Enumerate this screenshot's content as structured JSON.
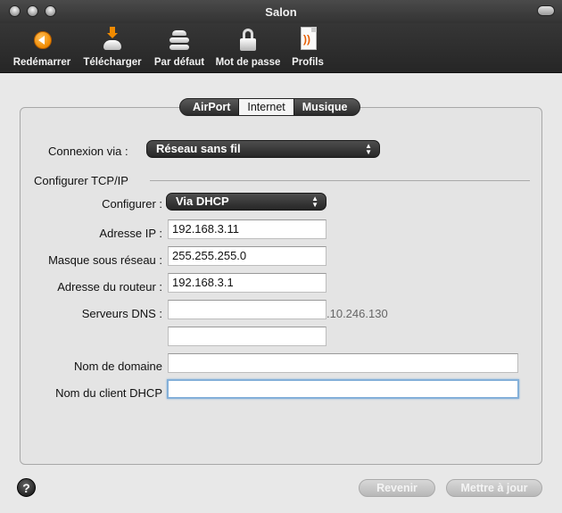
{
  "window": {
    "title": "Salon"
  },
  "toolbar": {
    "items": [
      {
        "label": "Redémarrer",
        "icon": "restart-icon"
      },
      {
        "label": "Télécharger",
        "icon": "download-icon"
      },
      {
        "label": "Par défaut",
        "icon": "default-settings-icon"
      },
      {
        "label": "Mot de passe",
        "icon": "lock-icon"
      },
      {
        "label": "Profils",
        "icon": "profiles-icon"
      }
    ]
  },
  "tabs": [
    {
      "label": "AirPort",
      "active": false
    },
    {
      "label": "Internet",
      "active": true
    },
    {
      "label": "Musique",
      "active": false
    }
  ],
  "connection": {
    "label": "Connexion via :",
    "value": "Réseau sans fil"
  },
  "tcpip": {
    "section_title": "Configurer TCP/IP",
    "configure_label": "Configurer :",
    "configure_value": "Via DHCP",
    "ip_label": "Adresse IP :",
    "ip_value": "192.168.3.11",
    "subnet_label": "Masque sous réseau :",
    "subnet_value": "255.255.255.0",
    "router_label": "Adresse du routeur :",
    "router_value": "192.168.3.1",
    "dns_label": "Serveurs DNS :",
    "dns1_value": "",
    "dns_hidden_text": ".10.246.130",
    "dns2_value": "",
    "domain_label": "Nom de domaine",
    "domain_value": "",
    "dhcp_client_label": "Nom du client DHCP",
    "dhcp_client_value": ""
  },
  "footer": {
    "help_label": "?",
    "revert_label": "Revenir",
    "update_label": "Mettre à jour"
  }
}
